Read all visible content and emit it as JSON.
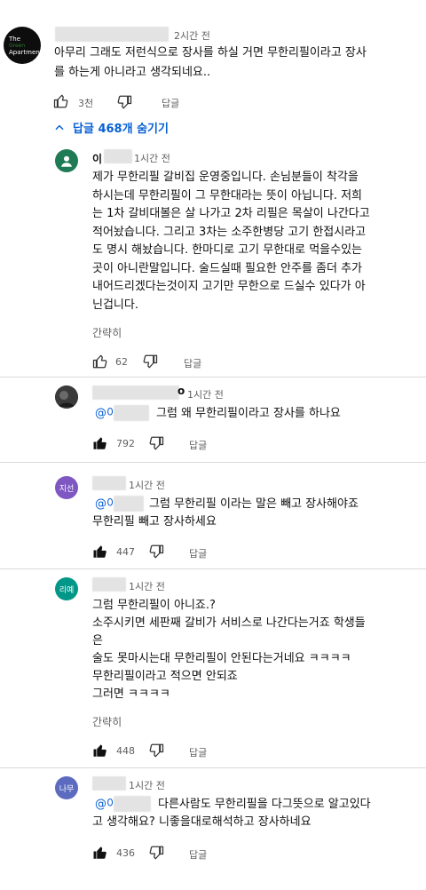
{
  "top": {
    "avatar_lines": [
      "The",
      "Green",
      "Apartment"
    ],
    "time": "2시간 전",
    "lines": [
      "아무리 그래도 저런식으로 장사를 하실 거면 무한리필이라고 장사",
      "를 하는게 아니라고 생각되네요.."
    ],
    "likes": "3천",
    "reply_label": "답글"
  },
  "toggle_replies": "답글 468개 숨기기",
  "replies": [
    {
      "name": "이",
      "time": "1시간 전",
      "lines": [
        "제가 무한리필 갈비집 운영중입니다. 손님분들이 착각을",
        "하시는데 무한리필이 그 무한대라는 뜻이 아닙니다. 저희",
        "는 1차 갈비대볼은 살 나가고 2차 리필은 목살이 나간다고",
        "적어놨습니다. 그리고 3차는 소주한병당 고기 한접시라고",
        "도 명시 해놨습니다. 한마디로 고기 무한대로 먹을수있는",
        "곳이 아니란말입니다. 술드실때 필요한 안주를 좀더 추가",
        "내어드리겠다는것이지 고기만 무한으로 드실수 있다가 아",
        "닌겁니다."
      ],
      "collapse": "간략히",
      "likes": "62",
      "reply_label": "답글"
    },
    {
      "name": "o",
      "time": "1시간 전",
      "mention": "@이",
      "lines": [
        "그럼 왜 무한리필이라고 장사를 하나요"
      ],
      "likes": "792",
      "reply_label": "답글"
    },
    {
      "avatar": "지선",
      "avatar_color": "#7e57c2",
      "time": "1시간 전",
      "mention": "@이",
      "lines": [
        "그럼 무한리필 이라는 말은 빼고 장사해야죠",
        "무한리필 빼고 장사하세요"
      ],
      "likes": "447",
      "reply_label": "답글"
    },
    {
      "avatar": "리예",
      "avatar_color": "#009688",
      "time": "1시간 전",
      "lines": [
        "그럼 무한리필이 아니죠.?",
        "소주시키면 세판째 갈비가 서비스로 나간다는거죠 학생들",
        "은",
        "술도 못마시는대 무한리필이 안된다는거네요 ㅋㅋㅋㅋ",
        "무한리필이라고 적으면 안되죠",
        "그러면 ㅋㅋㅋㅋ"
      ],
      "collapse": "간략히",
      "likes": "448",
      "reply_label": "답글"
    },
    {
      "avatar": "나무",
      "avatar_color": "#5c6bc0",
      "time": "1시간 전",
      "mention": "@이",
      "lines": [
        "다른사람도 무한리필을 다그뜻으로 알고있다",
        "고 생각해요? 니좋을대로해석하고 장사하네요"
      ],
      "likes": "436",
      "reply_label": "답글"
    }
  ],
  "colors": {
    "link_blue": "#065fd4",
    "meta_gray": "#606060"
  }
}
